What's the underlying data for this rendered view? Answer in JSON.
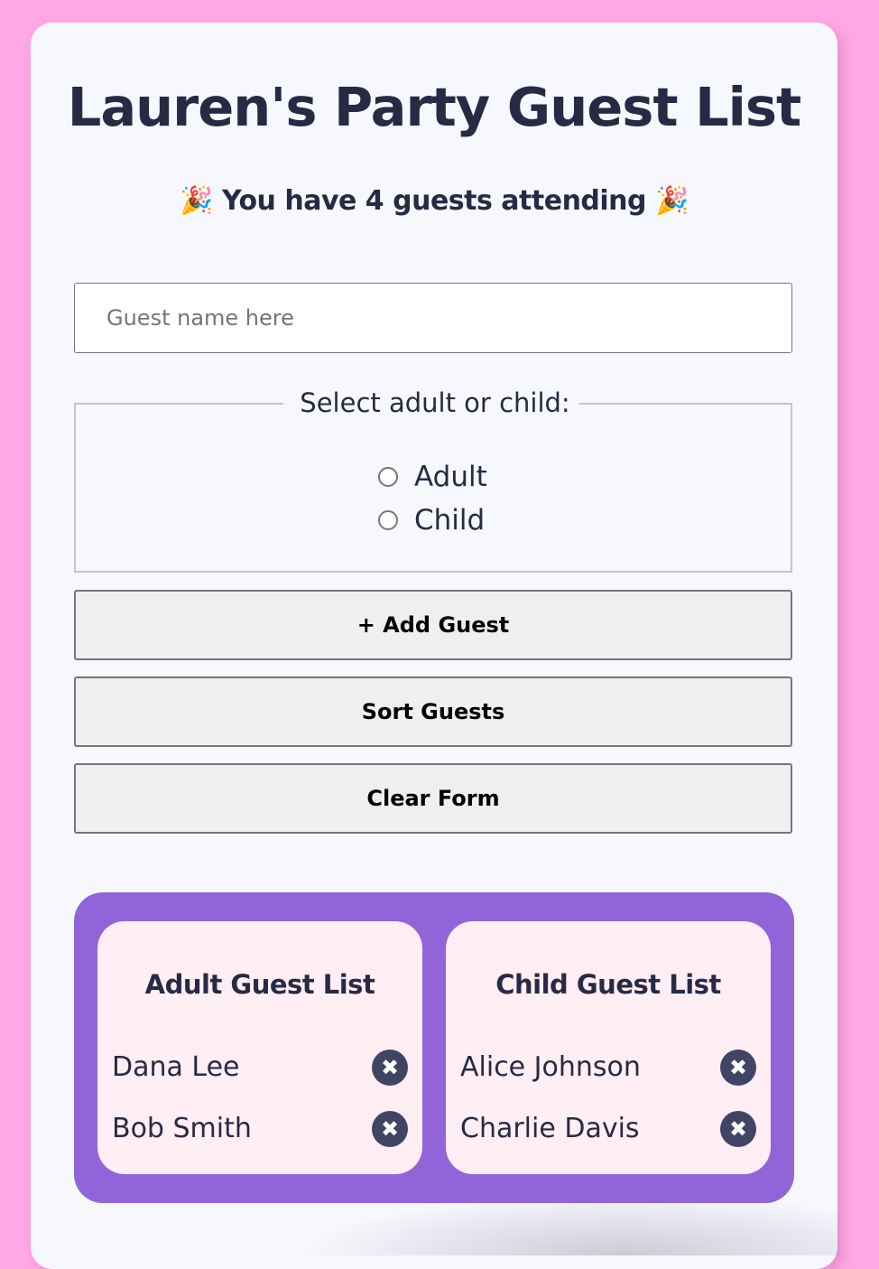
{
  "header": {
    "title": "Lauren's Party Guest List",
    "guest_count_text": "🎉 You have 4 guests attending 🎉"
  },
  "form": {
    "name_input": {
      "placeholder": "Guest name here",
      "value": ""
    },
    "type_fieldset": {
      "legend": "Select adult or child:",
      "options": [
        "Adult",
        "Child"
      ],
      "selected": null
    },
    "buttons": {
      "add": "+ Add Guest",
      "sort": "Sort Guests",
      "clear": "Clear Form"
    }
  },
  "lists": {
    "adult": {
      "title": "Adult Guest List",
      "guests": [
        "Dana Lee",
        "Bob Smith"
      ]
    },
    "child": {
      "title": "Child Guest List",
      "guests": [
        "Alice Johnson",
        "Charlie Davis"
      ]
    },
    "remove_icon_glyph": "✖"
  },
  "colors": {
    "page_background": "#ffa8e4",
    "card_background": "#f7f8fd",
    "text_primary": "#272a45",
    "lists_panel": "#9264d9",
    "list_card": "#ffeef4",
    "remove_button": "#404566"
  }
}
